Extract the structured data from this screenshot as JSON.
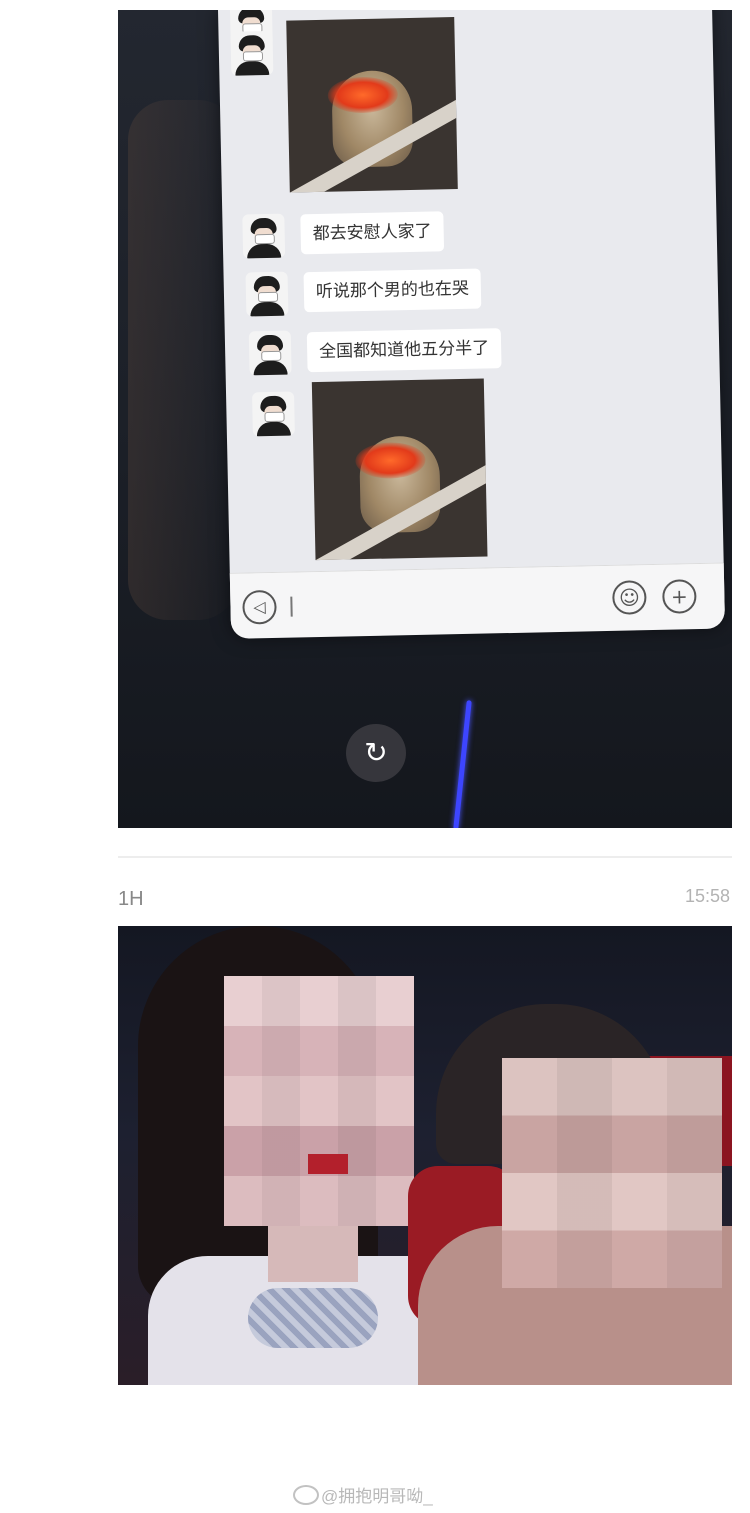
{
  "chat": {
    "messages": [
      {
        "type": "sticker"
      },
      {
        "type": "text",
        "text": "都去安慰人家了"
      },
      {
        "type": "text",
        "text": "听说那个男的也在哭"
      },
      {
        "type": "text",
        "text": "全国都知道他五分半了"
      },
      {
        "type": "sticker"
      }
    ],
    "input": {
      "placeholder": ""
    },
    "icons": {
      "voice": "voice-icon",
      "emoji": "emoji-icon",
      "add": "plus-icon"
    }
  },
  "viewer": {
    "rotate_icon": "rotate-icon"
  },
  "post2": {
    "label": "1H",
    "time": "15:58"
  },
  "watermark": {
    "text": "@拥抱明哥呦_"
  },
  "colors": {
    "page_bg": "#ffffff",
    "chat_bg": "#e9eaee",
    "bubble_bg": "#ffffff",
    "streak": "#3d45ff"
  }
}
